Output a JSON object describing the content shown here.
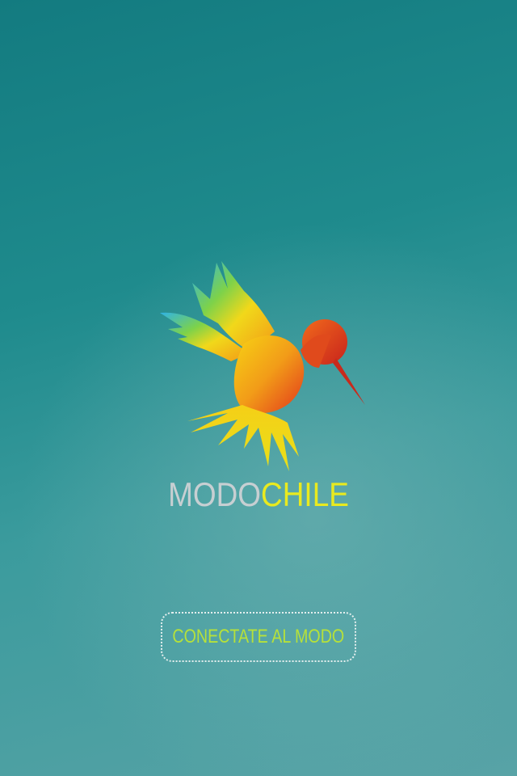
{
  "brand": {
    "part_a": "MODO",
    "part_b": "CHILE"
  },
  "logo": {
    "icon": "hummingbird-icon"
  },
  "connect_button": {
    "label": "CONECTATE AL MODO"
  },
  "colors": {
    "background_top": "#137b80",
    "background_bottom": "#58a3a6",
    "brand_gray": "#c7cfd2",
    "brand_yellow": "#e9ea1f",
    "button_text": "#b6e13a",
    "button_border": "#e4eeee"
  }
}
